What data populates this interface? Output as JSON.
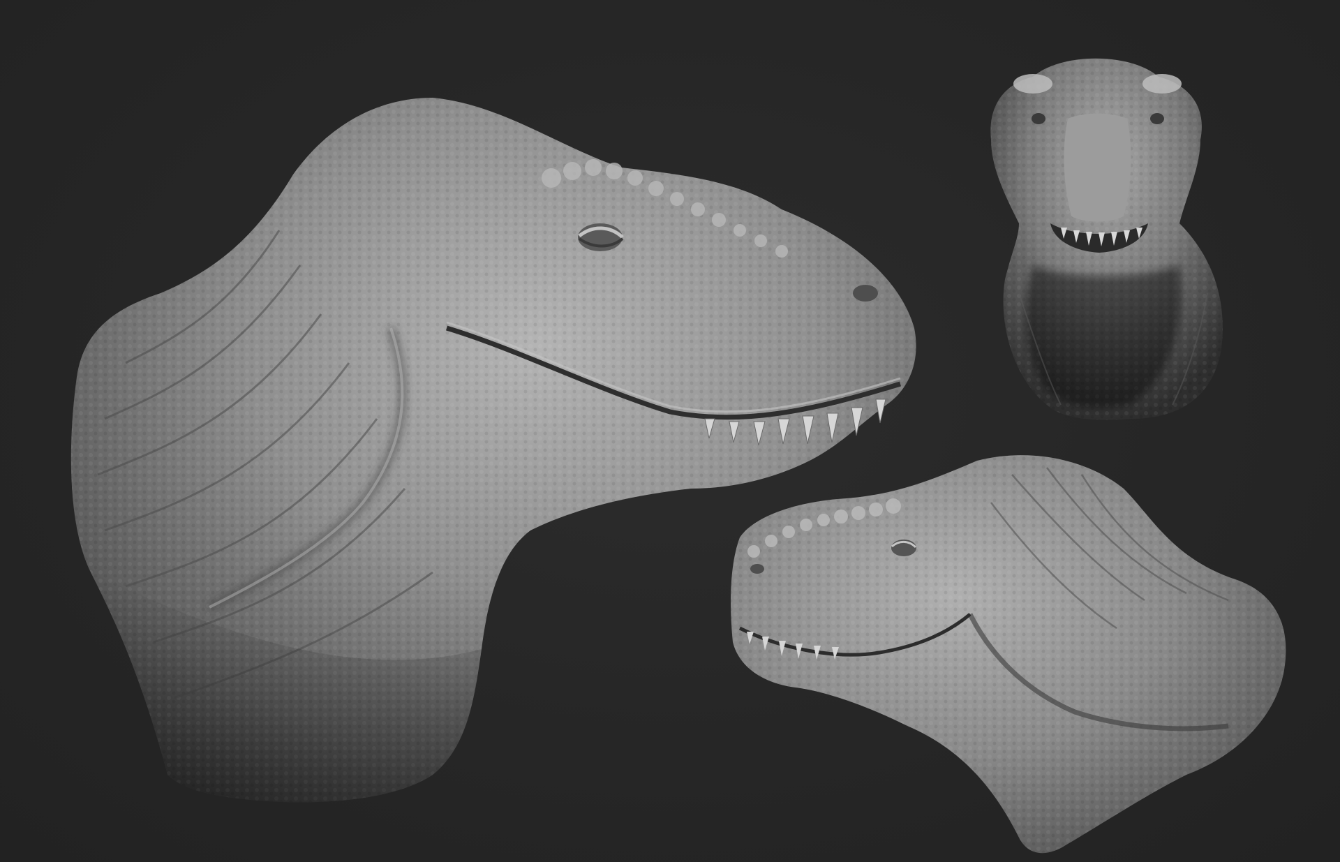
{
  "scene": {
    "background_color": "#262626",
    "clay_color": "#8c8c8c",
    "views": [
      {
        "name": "three-quarter-right-view",
        "subject": "t-rex-head-sculpt"
      },
      {
        "name": "front-view",
        "subject": "t-rex-head-sculpt"
      },
      {
        "name": "left-profile-view",
        "subject": "t-rex-head-sculpt"
      }
    ]
  }
}
